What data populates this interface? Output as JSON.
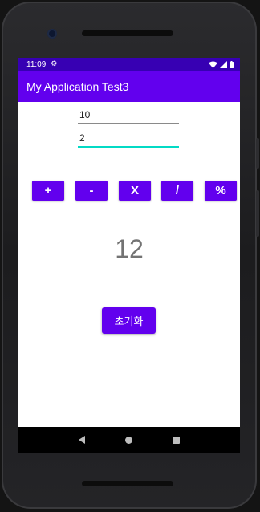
{
  "status_bar": {
    "time": "11:09",
    "icons": [
      "settings-gear-icon",
      "wifi-icon",
      "cellular-signal-icon",
      "battery-icon"
    ]
  },
  "app_bar": {
    "title": "My Application Test3"
  },
  "inputs": {
    "first_value": "10",
    "second_value": "2"
  },
  "operators": {
    "add": "+",
    "subtract": "-",
    "multiply": "X",
    "divide": "/",
    "modulo": "%"
  },
  "result": {
    "value": "12"
  },
  "reset_button": {
    "label": "초기화"
  },
  "nav_bar": {
    "icons": [
      "back-icon",
      "home-icon",
      "recents-icon"
    ]
  },
  "colors": {
    "primary": "#6200EE",
    "primary_dark": "#3700B3",
    "accent": "#03DAC5",
    "result_text": "#737373"
  }
}
